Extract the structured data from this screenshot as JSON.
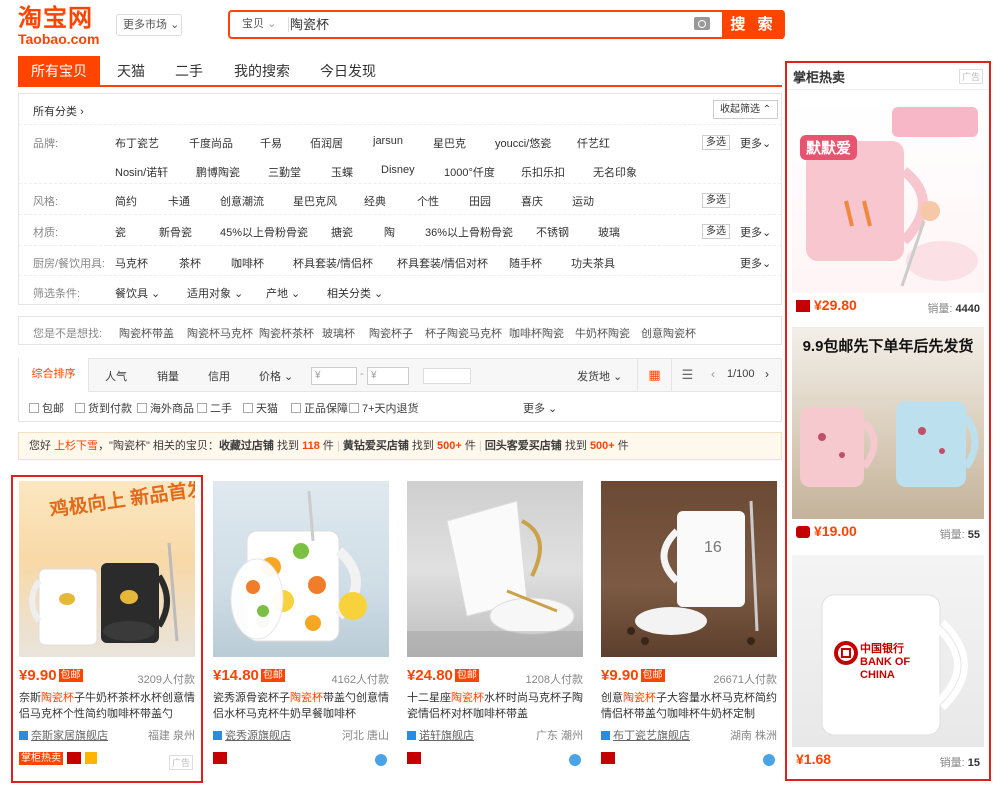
{
  "logo": {
    "cn": "淘宝网",
    "en": "Taobao.com"
  },
  "market_btn": "更多市场",
  "search": {
    "scope": "宝贝",
    "query": "陶瓷杯",
    "button": "搜 索"
  },
  "tabs": [
    "所有宝贝",
    "天猫",
    "二手",
    "我的搜索",
    "今日发现"
  ],
  "filters": {
    "all_categories": "所有分类",
    "collapse": "收起筛选",
    "brand_label": "品牌:",
    "brands_row1": [
      "布丁瓷艺",
      "千度尚品",
      "千易",
      "佰润居",
      "jarsun",
      "星巴克",
      "youcci/悠瓷",
      "仟艺红"
    ],
    "brands_row2": [
      "Nosin/诺轩",
      "鹏博陶瓷",
      "三勤堂",
      "玉蝶",
      "Disney",
      "1000°仟度",
      "乐扣乐扣",
      "无名印象"
    ],
    "style_label": "风格:",
    "styles": [
      "简约",
      "卡通",
      "创意潮流",
      "星巴克风",
      "经典",
      "个性",
      "田园",
      "喜庆",
      "运动"
    ],
    "material_label": "材质:",
    "materials": [
      "瓷",
      "新骨瓷",
      "45%以上骨粉骨瓷",
      "搪瓷",
      "陶",
      "36%以上骨粉骨瓷",
      "不锈钢",
      "玻璃"
    ],
    "kitchen_label": "厨房/餐饮用具:",
    "kitchen": [
      "马克杯",
      "茶杯",
      "咖啡杯",
      "杯具套装/情侣杯",
      "杯具套装/情侣对杯",
      "随手杯",
      "功夫茶具"
    ],
    "cond_label": "筛选条件:",
    "conditions": [
      "餐饮具",
      "适用对象",
      "产地",
      "相关分类"
    ],
    "multi": "多选",
    "more": "更多"
  },
  "suggest": {
    "label": "您是不是想找:",
    "items": [
      "陶瓷杯带盖",
      "陶瓷杯马克杯",
      "陶瓷杯茶杯",
      "玻璃杯",
      "陶瓷杯子",
      "杯子陶瓷马克杯",
      "咖啡杯陶瓷",
      "牛奶杯陶瓷",
      "创意陶瓷杯"
    ]
  },
  "sort": {
    "items": [
      "综合排序",
      "人气",
      "销量",
      "信用",
      "价格"
    ],
    "price_from": "¥",
    "price_to": "¥",
    "ship": "发货地",
    "page": "1/100"
  },
  "checks": {
    "items": [
      "包邮",
      "货到付款",
      "海外商品",
      "二手",
      "天猫",
      "正品保障",
      "7+天内退货"
    ],
    "more": "更多"
  },
  "notice": {
    "p1": "您好",
    "user": "上杉下雪",
    "p2": "，\"陶瓷杯\" 相关的宝贝：",
    "s1": "收藏过店铺",
    "f1": "找到",
    "n1": "118",
    "u1": "件",
    "s2": "黄钻爱买店铺",
    "f2": "找到",
    "n2": "500+",
    "u2": "件",
    "s3": "回头客爱买店铺",
    "f3": "找到",
    "n3": "500+",
    "u3": "件"
  },
  "products": [
    {
      "price": "¥9.90",
      "tag": "包邮",
      "paid": "3209人付款",
      "title_pre": "奈斯",
      "title_hl": "陶瓷杯",
      "title_post": "子牛奶杯茶杯水杯创意情侣马克杯个性简约咖啡杯带盖勺",
      "shop": "奈斯家居旗舰店",
      "loc": "福建 泉州",
      "hot": "掌柜热卖",
      "ad": "广告",
      "img_text": "鸡极向上 新品首发"
    },
    {
      "price": "¥14.80",
      "tag": "包邮",
      "paid": "4162人付款",
      "title_pre": "瓷秀源骨瓷杯子",
      "title_hl": "陶瓷杯",
      "title_post": "带盖勺创意情侣水杯马克杯牛奶早餐咖啡杯",
      "shop": "瓷秀源旗舰店",
      "loc": "河北 唐山"
    },
    {
      "price": "¥24.80",
      "tag": "包邮",
      "paid": "1208人付款",
      "title_pre": "十二星座",
      "title_hl": "陶瓷杯",
      "title_post": "水杯时尚马克杯子陶瓷情侣杯对杯咖啡杯带盖",
      "shop": "诺轩旗舰店",
      "loc": "广东 潮州"
    },
    {
      "price": "¥9.90",
      "tag": "包邮",
      "paid": "26671人付款",
      "title_pre": "创意",
      "title_hl": "陶瓷杯",
      "title_post": "子大容量水杯马克杯简约情侣杯带盖勺咖啡杯牛奶杯定制",
      "shop": "布丁瓷艺旗舰店",
      "loc": "湖南 株洲",
      "img_text": "16"
    }
  ],
  "sidebar": {
    "title": "掌柜热卖",
    "ad": "广告",
    "items": [
      {
        "price": "¥29.80",
        "sales_label": "销量:",
        "sales": "4440",
        "img_text": "默默爱"
      },
      {
        "price": "¥19.00",
        "sales_label": "销量:",
        "sales": "55",
        "img_text": "9.9包邮先下单年后先发货"
      },
      {
        "price": "¥1.68",
        "sales_label": "销量:",
        "sales": "15",
        "img_text": "中国银行 BANK OF CHINA"
      }
    ]
  }
}
